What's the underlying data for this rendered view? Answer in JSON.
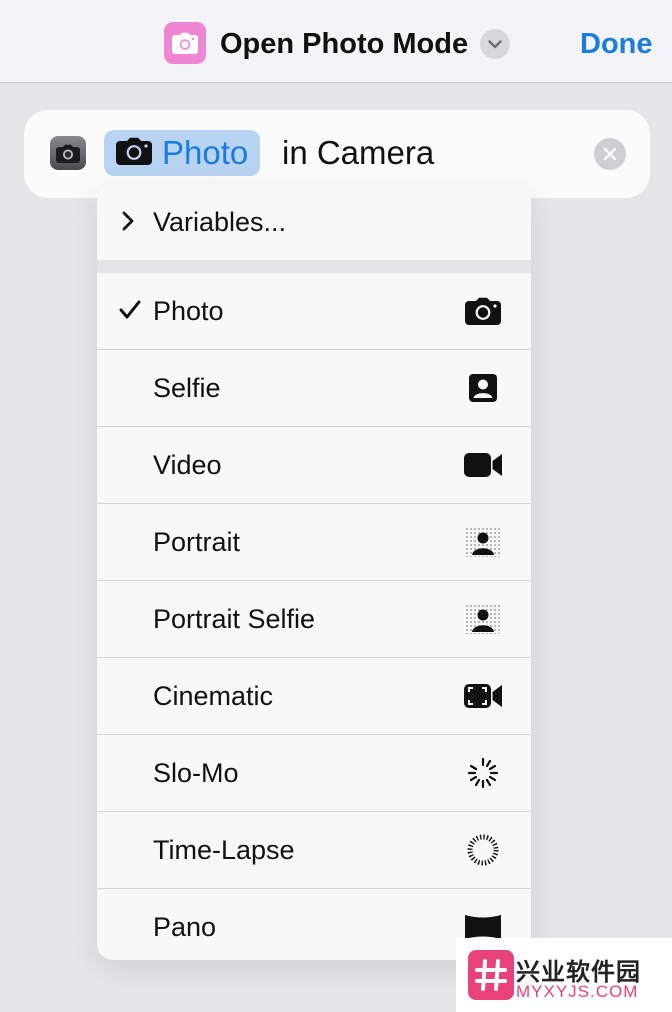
{
  "header": {
    "title": "Open Photo Mode",
    "done_label": "Done",
    "icon": "camera-icon",
    "accent": "#1a7be0",
    "icon_bg": "#ef86d3"
  },
  "action": {
    "param_value": "Photo",
    "rest_text": "in Camera",
    "app_icon": "camera-app-icon"
  },
  "menu": {
    "variables_label": "Variables...",
    "selected": "Photo",
    "items": [
      {
        "label": "Photo",
        "icon": "camera-icon",
        "checked": true
      },
      {
        "label": "Selfie",
        "icon": "selfie-icon",
        "checked": false
      },
      {
        "label": "Video",
        "icon": "video-icon",
        "checked": false
      },
      {
        "label": "Portrait",
        "icon": "portrait-icon",
        "checked": false
      },
      {
        "label": "Portrait Selfie",
        "icon": "portrait-selfie-icon",
        "checked": false
      },
      {
        "label": "Cinematic",
        "icon": "cinematic-icon",
        "checked": false
      },
      {
        "label": "Slo-Mo",
        "icon": "slo-mo-icon",
        "checked": false
      },
      {
        "label": "Time-Lapse",
        "icon": "time-lapse-icon",
        "checked": false
      },
      {
        "label": "Pano",
        "icon": "pano-icon",
        "checked": false
      }
    ]
  },
  "watermark": {
    "title": "兴业软件园",
    "subtitle": "MYXYJS.COM"
  }
}
